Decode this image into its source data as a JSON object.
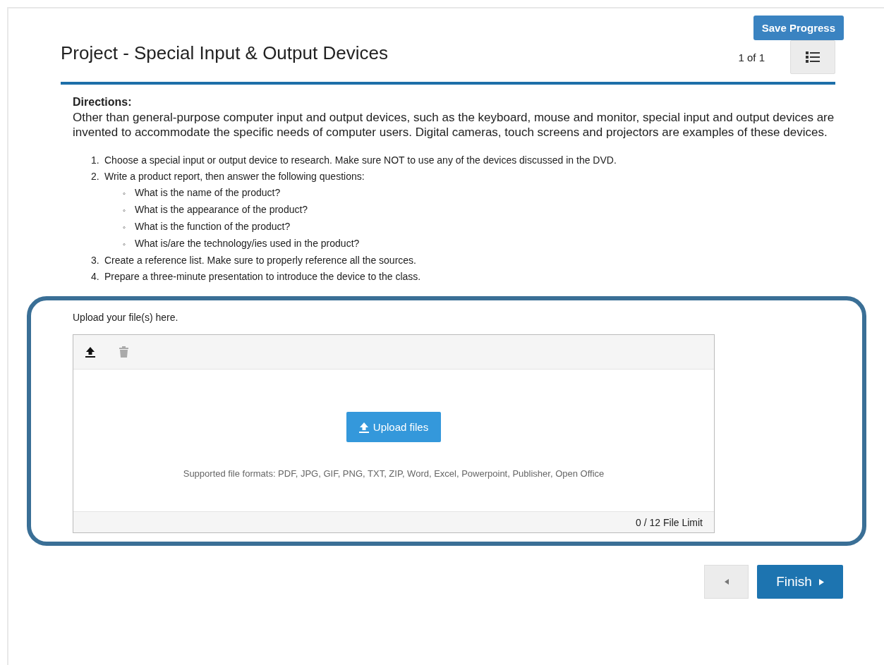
{
  "header": {
    "save_button": "Save Progress",
    "title": "Project - Special Input & Output Devices",
    "page_count": "1 of 1"
  },
  "directions": {
    "heading": "Directions:",
    "text": "Other than general-purpose computer input and output devices, such as the keyboard, mouse and monitor, special input and output devices are invented to accommodate the specific needs of computer users. Digital cameras, touch screens and projectors are examples of these devices.",
    "steps": [
      {
        "marker": "1.",
        "text": "Choose a special input or output device to research. Make sure NOT to use any of the devices discussed in the DVD."
      },
      {
        "marker": "2.",
        "text": "Write a product report, then answer the following questions:",
        "children": [
          {
            "marker": "◦",
            "text": "What is the name of the product?"
          },
          {
            "marker": "◦",
            "text": "What is the appearance of the product?"
          },
          {
            "marker": "◦",
            "text": "What is the function of the product?"
          },
          {
            "marker": "◦",
            "text": "What is/are the technology/ies used in the product?"
          }
        ]
      },
      {
        "marker": "3.",
        "text": "Create a reference list. Make sure to properly reference all the sources."
      },
      {
        "marker": "4.",
        "text": "Prepare a three-minute presentation to introduce the device to the class."
      }
    ]
  },
  "upload": {
    "label": "Upload your file(s) here.",
    "toolbar": [
      {
        "kind": "upload",
        "disabled": false
      },
      {
        "kind": "delete",
        "disabled": true
      }
    ],
    "button": "Upload files",
    "formats": "Supported file formats: PDF, JPG, GIF, PNG, TXT, ZIP, Word, Excel, Powerpoint, Publisher, Open Office",
    "limit": "0 / 12 File Limit"
  },
  "footer": {
    "finish_button": "Finish"
  }
}
